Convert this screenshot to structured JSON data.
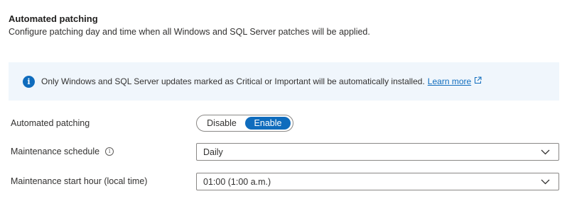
{
  "section": {
    "title": "Automated patching",
    "description": "Configure patching day and time when all Windows and SQL Server patches will be applied."
  },
  "info_banner": {
    "icon": "info-icon",
    "text": "Only Windows and SQL Server updates marked as Critical or Important will be automatically installed.",
    "link_label": "Learn more",
    "link_icon": "external-link-icon"
  },
  "automated_patching": {
    "label": "Automated patching",
    "options": [
      "Disable",
      "Enable"
    ],
    "selected": "Enable"
  },
  "maintenance_schedule": {
    "label": "Maintenance schedule",
    "value": "Daily"
  },
  "maintenance_start_hour": {
    "label": "Maintenance start hour (local time)",
    "value": "01:00 (1:00 a.m.)"
  },
  "colors": {
    "accent": "#0f6cbd",
    "banner_bg": "#f0f6fc",
    "border": "#8a8886",
    "text": "#323130"
  }
}
